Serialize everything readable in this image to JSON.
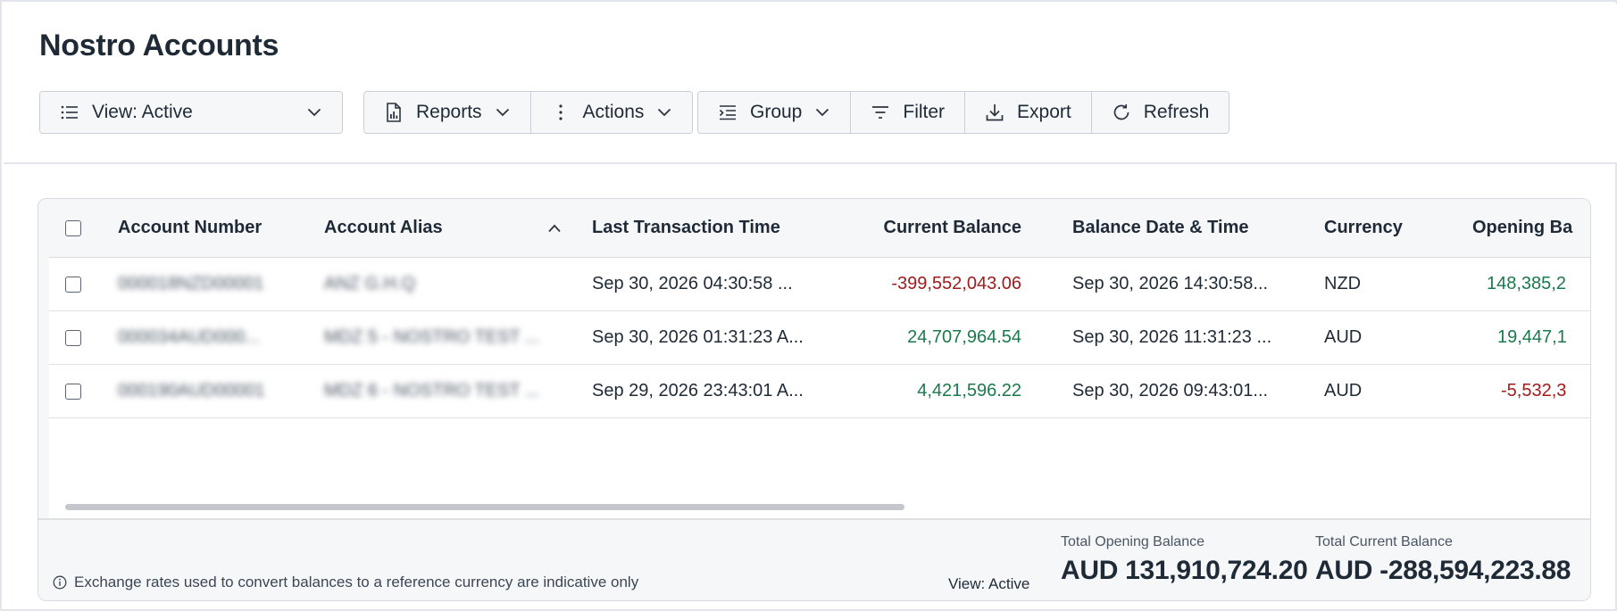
{
  "page": {
    "title": "Nostro Accounts"
  },
  "toolbar": {
    "view_label": "View: Active",
    "reports_label": "Reports",
    "actions_label": "Actions",
    "group_label": "Group",
    "filter_label": "Filter",
    "export_label": "Export",
    "refresh_label": "Refresh"
  },
  "table": {
    "headers": {
      "account_number": "Account Number",
      "account_alias": "Account Alias",
      "last_transaction_time": "Last Transaction Time",
      "current_balance": "Current Balance",
      "balance_datetime": "Balance Date & Time",
      "currency": "Currency",
      "opening_balance": "Opening Ba"
    },
    "rows": [
      {
        "account_number": "000018NZD00001",
        "account_alias": "ANZ G.H.Q",
        "last_transaction_time": "Sep 30, 2026 04:30:58 ...",
        "current_balance": "-399,552,043.06",
        "balance_datetime": "Sep 30, 2026 14:30:58...",
        "currency": "NZD",
        "opening_balance": "148,385,2"
      },
      {
        "account_number": "000034AUD000...",
        "account_alias": "MDZ 5 - NOSTRO TEST ...",
        "last_transaction_time": "Sep 30, 2026 01:31:23 A...",
        "current_balance": "24,707,964.54",
        "balance_datetime": "Sep 30, 2026 11:31:23 ...",
        "currency": "AUD",
        "opening_balance": "19,447,1"
      },
      {
        "account_number": "000190AUD00001",
        "account_alias": "MDZ 6 - NOSTRO TEST ...",
        "last_transaction_time": "Sep 29, 2026 23:43:01 A...",
        "current_balance": "4,421,596.22",
        "balance_datetime": "Sep 30, 2026 09:43:01...",
        "currency": "AUD",
        "opening_balance": "-5,532,3"
      }
    ]
  },
  "footer": {
    "note": "Exchange rates used to convert balances to a reference currency are indicative only",
    "view_label": "View: Active",
    "total_opening_label": "Total Opening Balance",
    "total_opening_value": "AUD 131,910,724.20",
    "total_current_label": "Total Current Balance",
    "total_current_value": "AUD -288,594,223.88"
  },
  "colors": {
    "negative": "#a01b1b",
    "positive": "#1a7a4c",
    "text": "#1f2a37",
    "border": "#c9ced6"
  }
}
